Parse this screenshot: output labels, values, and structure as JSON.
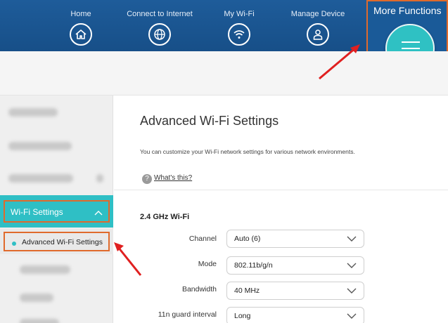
{
  "nav": {
    "items": [
      {
        "label": "Home",
        "icon": "home-icon"
      },
      {
        "label": "Connect to Internet",
        "icon": "globe-icon"
      },
      {
        "label": "My Wi-Fi",
        "icon": "wifi-icon"
      },
      {
        "label": "Manage Device",
        "icon": "user-icon"
      }
    ],
    "more_label": "More Functions",
    "more_icon": "hamburger-menu-icon"
  },
  "sidebar": {
    "wifi_settings_label": "Wi-Fi Settings",
    "advanced_label": "Advanced Wi-Fi Settings"
  },
  "main": {
    "title": "Advanced Wi-Fi Settings",
    "description": "You can customize your Wi-Fi network settings for various network environments.",
    "help_icon": "?",
    "help_link": "What's this?",
    "section_title": "2.4 GHz Wi-Fi",
    "fields": [
      {
        "label": "Channel",
        "value": "Auto (6)"
      },
      {
        "label": "Mode",
        "value": "802.11b/g/n"
      },
      {
        "label": "Bandwidth",
        "value": "40 MHz"
      },
      {
        "label": "11n guard interval",
        "value": "Long"
      }
    ]
  },
  "colors": {
    "nav_bg": "#1e5c9a",
    "accent_teal": "#2fbfc5",
    "highlight_orange": "#e06a2c",
    "arrow_red": "#e02020"
  }
}
